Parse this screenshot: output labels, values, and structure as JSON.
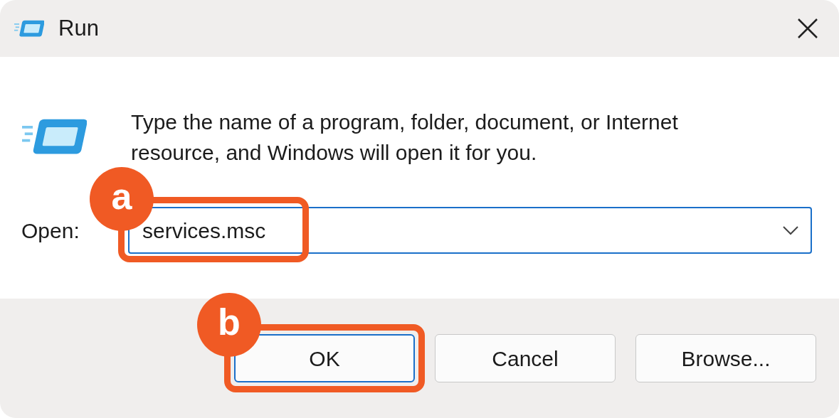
{
  "window": {
    "title": "Run"
  },
  "instruction": "Type the name of a program, folder, document, or Internet resource, and Windows will open it for you.",
  "open_field": {
    "label": "Open:",
    "value": "services.msc",
    "callout": "a"
  },
  "buttons": [
    {
      "label": "OK",
      "default": true,
      "callout": "b"
    },
    {
      "label": "Cancel",
      "default": false
    },
    {
      "label": "Browse...",
      "default": false
    }
  ]
}
